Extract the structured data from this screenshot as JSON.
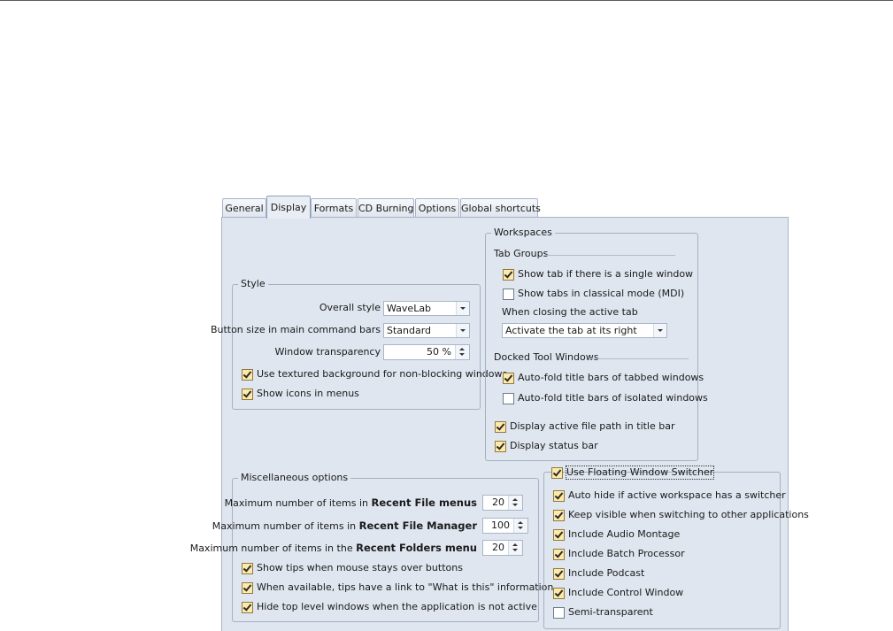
{
  "tabs": [
    "General",
    "Display",
    "Formats",
    "CD Burning",
    "Options",
    "Global shortcuts"
  ],
  "style_group": {
    "title": "Style",
    "overall_style_label": "Overall style",
    "overall_style_value": "WaveLab",
    "button_size_label": "Button size in main command bars",
    "button_size_value": "Standard",
    "transparency_label": "Window transparency",
    "transparency_value": "50 %",
    "textured_bg": {
      "label": "Use textured background for non-blocking windows",
      "checked": true
    },
    "icons_in_menus": {
      "label": "Show icons in menus",
      "checked": true
    }
  },
  "workspaces_group": {
    "title": "Workspaces",
    "tab_groups_title": "Tab Groups",
    "single_window": {
      "label": "Show tab if there is a single window",
      "checked": true
    },
    "classical_mode": {
      "label": "Show tabs in classical mode (MDI)",
      "checked": false
    },
    "closing_label": "When closing the active tab",
    "closing_value": "Activate the tab at its right",
    "docked_title": "Docked Tool Windows",
    "autofold_tabbed": {
      "label": "Auto-fold title bars of tabbed windows",
      "checked": true
    },
    "autofold_isolated": {
      "label": "Auto-fold title bars of isolated windows",
      "checked": false
    },
    "file_path": {
      "label": "Display active file path in title bar",
      "checked": true
    },
    "status_bar": {
      "label": "Display status bar",
      "checked": true
    }
  },
  "misc_group": {
    "title": "Miscellaneous options",
    "recent_files": {
      "prefix": "Maximum number of items in",
      "bold": "Recent File menus",
      "value": "20"
    },
    "recent_manager": {
      "prefix": "Maximum number of items in",
      "bold": "Recent File Manager",
      "value": "100"
    },
    "recent_folders": {
      "prefix": "Maximum number of items in the",
      "bold": "Recent Folders menu",
      "value": "20"
    },
    "tips": {
      "label": "Show tips when mouse stays over buttons",
      "checked": true
    },
    "whats_this": {
      "label": "When available, tips have a link to \"What is this\" information",
      "checked": true
    },
    "hide_top": {
      "label": "Hide top level windows when the application is not active",
      "checked": true
    }
  },
  "switcher_group": {
    "title": {
      "label": "Use Floating Window Switcher",
      "checked": true
    },
    "items": [
      {
        "label": "Auto hide if active workspace has a switcher",
        "checked": true
      },
      {
        "label": "Keep visible when switching to other applications",
        "checked": true
      },
      {
        "label": "Include Audio Montage",
        "checked": true
      },
      {
        "label": "Include Batch Processor",
        "checked": true
      },
      {
        "label": "Include Podcast",
        "checked": true
      },
      {
        "label": "Include Control Window",
        "checked": true
      },
      {
        "label": "Semi-transparent",
        "checked": false
      }
    ]
  }
}
